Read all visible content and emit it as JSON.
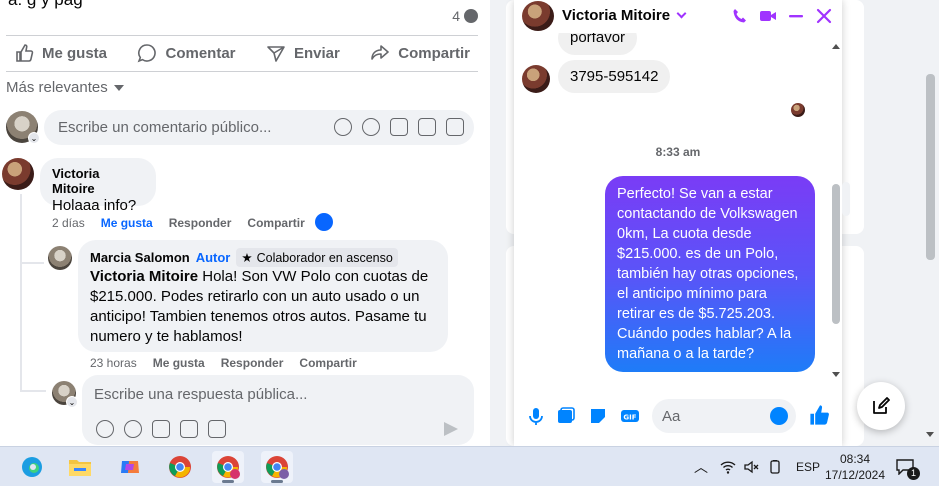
{
  "post": {
    "top_text": "a: g y   pag",
    "comment_count": "4",
    "actions": {
      "like": "Me gusta",
      "comment": "Comentar",
      "send": "Enviar",
      "share": "Compartir"
    },
    "sort_label": "Más relevantes",
    "comment_placeholder": "Escribe un comentario público...",
    "reply_placeholder": "Escribe una respuesta pública..."
  },
  "comments": [
    {
      "author": "Victoria Mitoire",
      "text": "Holaaa info?",
      "time": "2 días",
      "like": "Me gusta",
      "reply": "Responder",
      "share": "Compartir"
    },
    {
      "author": "Marcia Salomon",
      "author_tag": "Autor",
      "badge": "Colaborador en ascenso",
      "mention": "Victoria Mitoire",
      "text": " Hola! Son VW Polo con cuotas de $215.000. Podes retirarlo con un auto usado o un anticipo! Tambien tenemos otros autos. Pasame tu numero y te hablamos!",
      "time": "23 horas",
      "like": "Me gusta",
      "reply": "Responder",
      "share": "Compartir"
    }
  ],
  "chat": {
    "contact_name": "Victoria Mitoire",
    "partial_message": "porfavor",
    "phone_message": "3795-595142",
    "timestamp": "8:33 am",
    "outgoing_message": "Perfecto!  Se van a estar contactando de Volkswagen 0km, La cuota desde $215.000. es de un Polo, también hay otras opciones, el anticipo mínimo para retirar es de $5.725.203. Cuándo podes hablar? A la mañana o a la tarde?",
    "composer_placeholder": "Aa",
    "accent_color": "#a033ff"
  },
  "taskbar": {
    "language": "ESP",
    "time": "08:34",
    "date": "17/12/2024",
    "notification_count": "1"
  }
}
